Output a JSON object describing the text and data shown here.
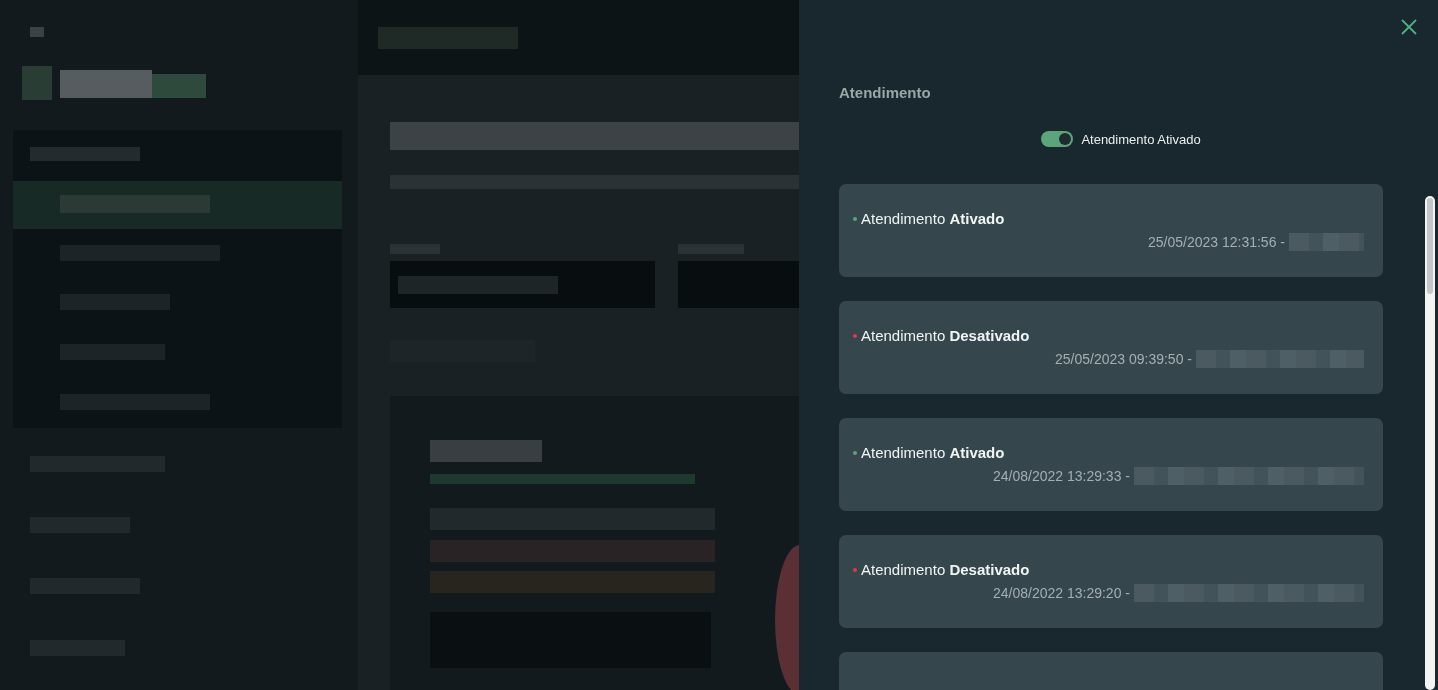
{
  "panel": {
    "title": "Atendimento",
    "toggle": {
      "label": "Atendimento Ativado",
      "on": true
    },
    "entries": [
      {
        "color": "#5aa57a",
        "text": "Atendimento **Ativado**",
        "timestamp": "25/05/2023 12:31:56 -"
      },
      {
        "color": "#e0364f",
        "text": "Atendimento **Desativado**",
        "timestamp": "25/05/2023 09:39:50 -"
      },
      {
        "color": "#5aa57a",
        "text": "Atendimento **Ativado**",
        "timestamp": "24/08/2022 13:29:33 -"
      },
      {
        "color": "#e0364f",
        "text": "Atendimento **Desativado**",
        "timestamp": "24/08/2022 13:29:20 -"
      }
    ]
  }
}
